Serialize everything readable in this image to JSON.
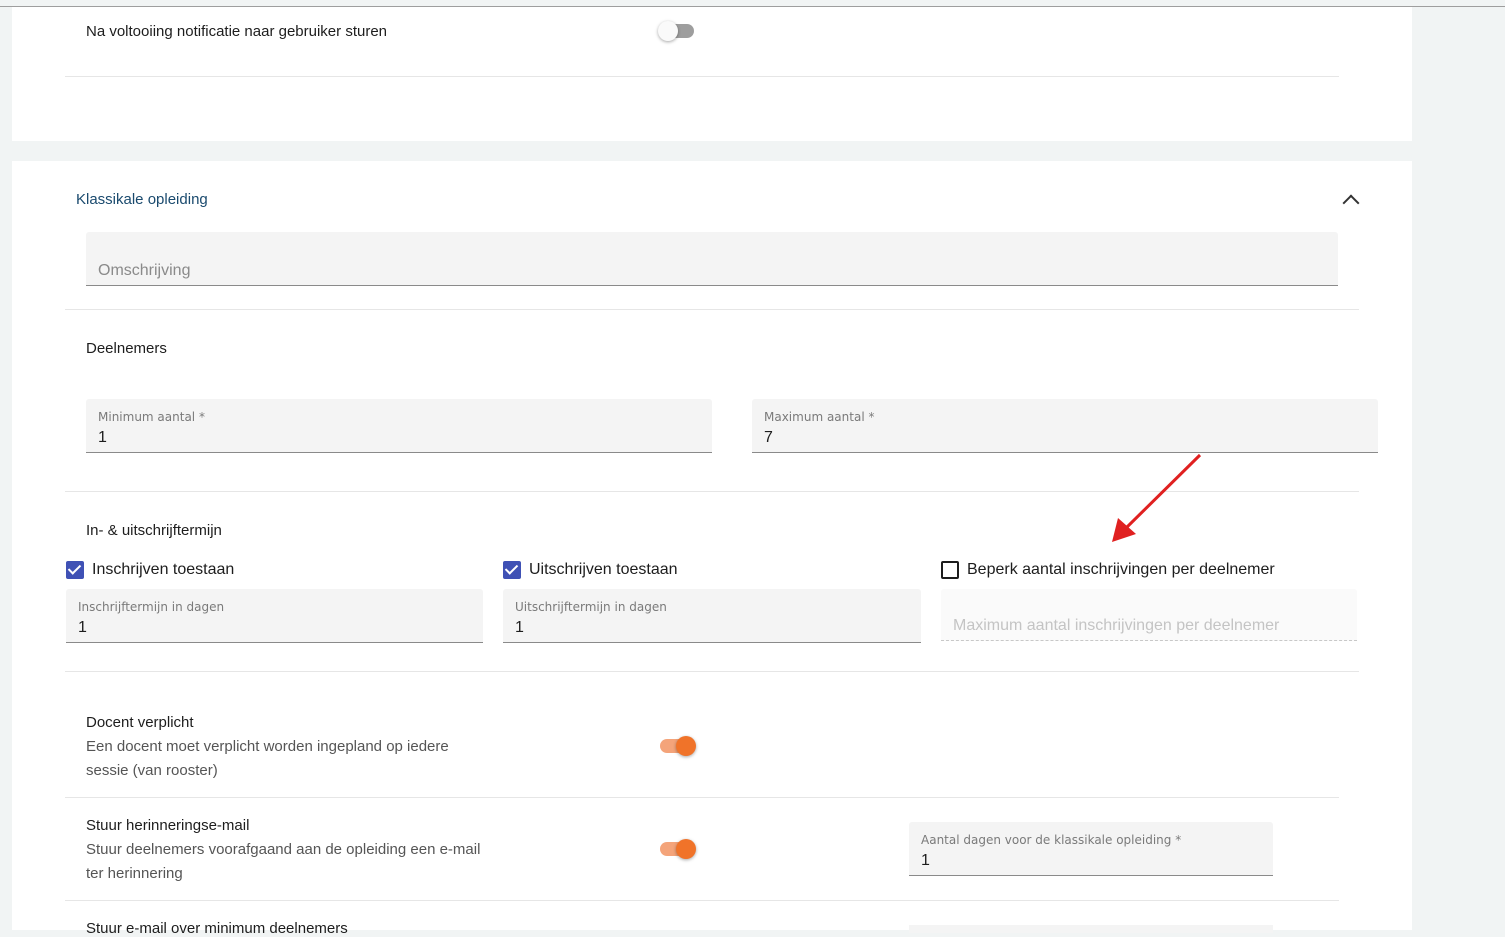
{
  "notify": {
    "label": "Na voltooiing notificatie naar gebruiker sturen",
    "enabled": false
  },
  "section": {
    "title": "Klassikale opleiding",
    "description_placeholder": "Omschrijving"
  },
  "participants": {
    "heading": "Deelnemers",
    "min_label": "Minimum aantal *",
    "min_value": "1",
    "max_label": "Maximum aantal *",
    "max_value": "7"
  },
  "terms": {
    "heading": "In- & uitschrijftermijn",
    "enroll_allowed_label": "Inschrijven toestaan",
    "enroll_allowed": true,
    "unenroll_allowed_label": "Uitschrijven toestaan",
    "unenroll_allowed": true,
    "limit_label": "Beperk aantal inschrijvingen per deelnemer",
    "limit_checked": false,
    "enroll_term_label": "Inschrijftermijn in dagen",
    "enroll_term_value": "1",
    "unenroll_term_label": "Uitschrijftermijn in dagen",
    "unenroll_term_value": "1",
    "limit_placeholder": "Maximum aantal inschrijvingen per deelnemer"
  },
  "teacher": {
    "title": "Docent verplicht",
    "description_line1": "Een docent moet verplicht worden ingepland op iedere",
    "description_line2": "sessie (van rooster)",
    "enabled": true
  },
  "reminder": {
    "title": "Stuur herinneringse-mail",
    "description_line1": "Stuur deelnemers voorafgaand aan de opleiding een e-mail",
    "description_line2": "ter herinnering",
    "enabled": true,
    "days_label": "Aantal dagen voor de klassikale opleiding *",
    "days_value": "1"
  },
  "min_mail": {
    "title": "Stuur e-mail over minimum deelnemers"
  },
  "colors": {
    "accent": "#f07329",
    "checkbox": "#3f51b5",
    "section_title": "#1a4a6e",
    "annotation_arrow": "#e02020"
  }
}
